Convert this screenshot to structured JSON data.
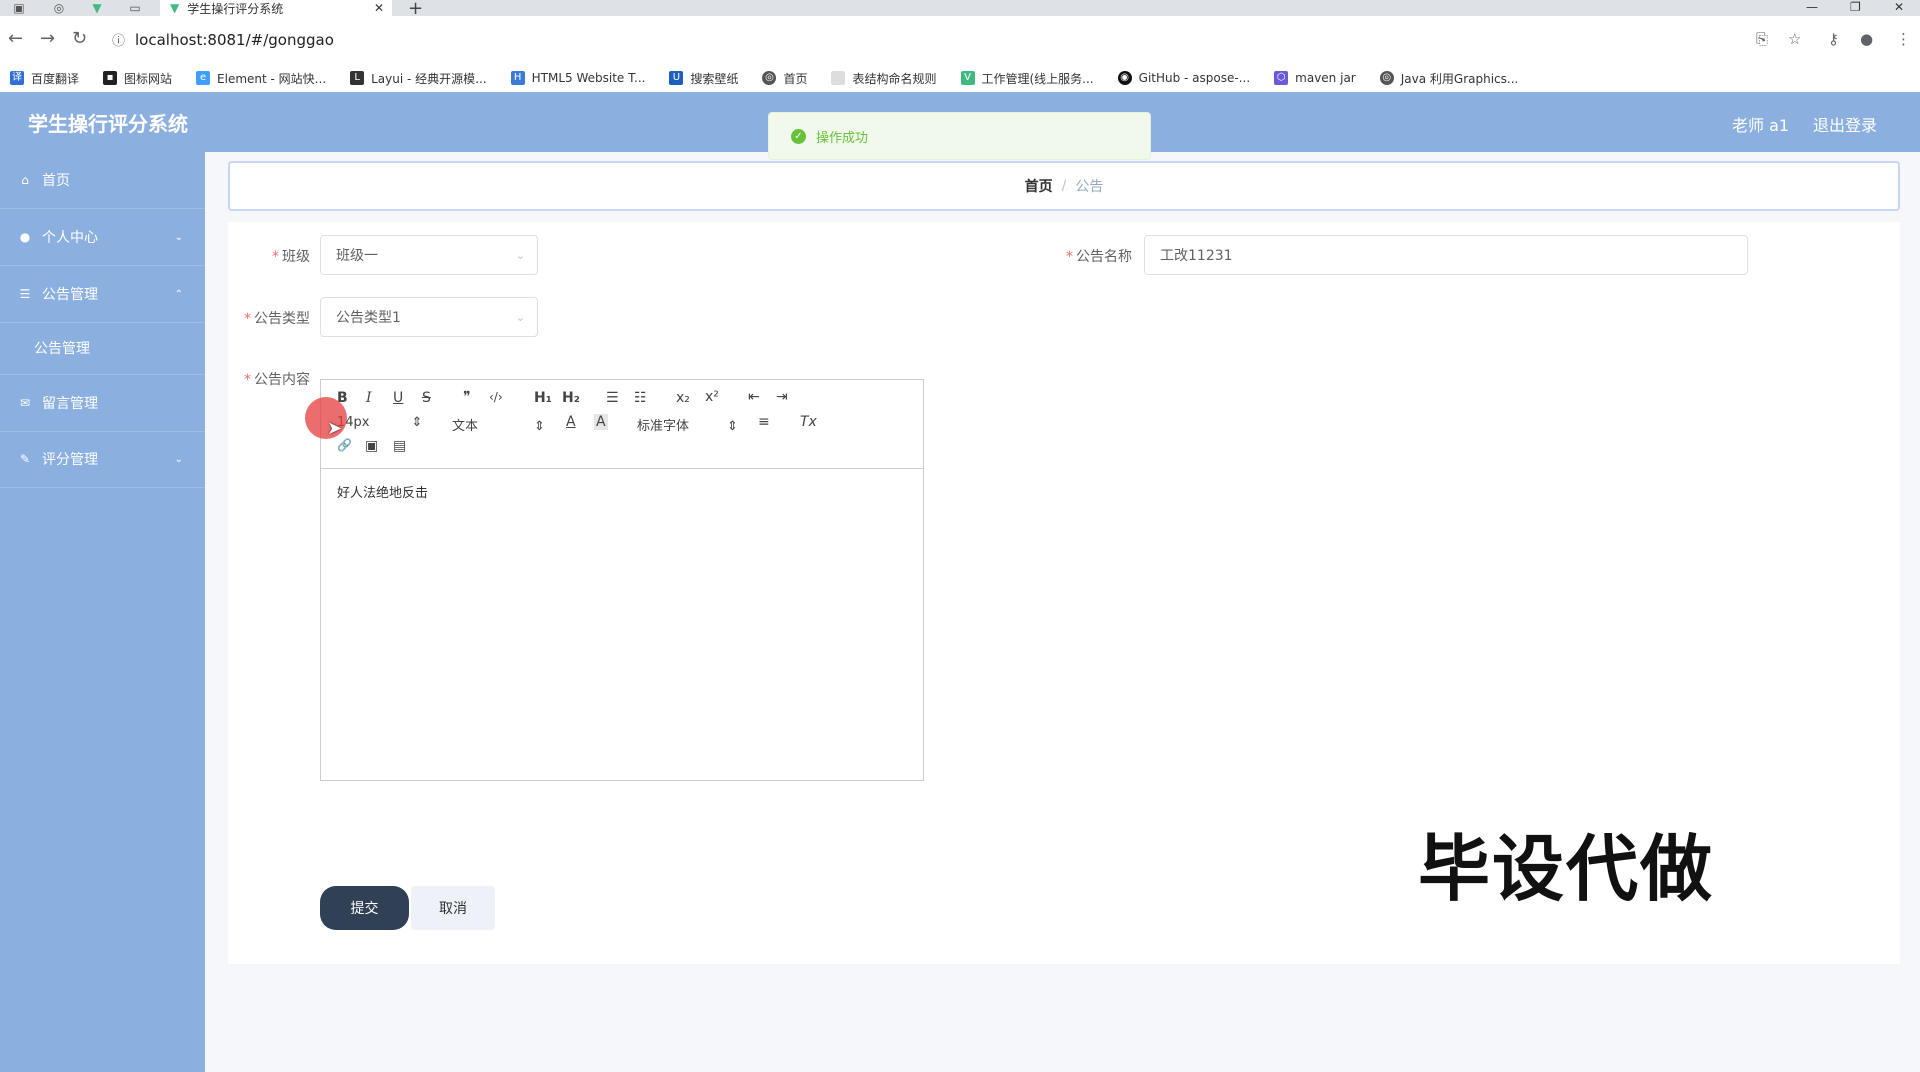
{
  "browser": {
    "active_tab_title": "学生操行评分系统",
    "url": "localhost:8081/#/gonggao",
    "bookmarks": [
      "百度翻译",
      "图标网站",
      "Element - 网站快...",
      "Layui - 经典开源模...",
      "HTML5 Website T...",
      "搜索壁纸",
      "首页",
      "表结构命名规则",
      "工作管理(线上服务...",
      "GitHub - aspose-...",
      "maven jar",
      "Java 利用Graphics..."
    ]
  },
  "header": {
    "title": "学生操行评分系统",
    "user": "老师 a1",
    "logout": "退出登录"
  },
  "toast": {
    "message": "操作成功",
    "color": "#67c23a"
  },
  "sidebar": {
    "items": [
      {
        "label": "首页",
        "icon": "home-icon"
      },
      {
        "label": "个人中心",
        "icon": "user-icon"
      },
      {
        "label": "公告管理",
        "icon": "menu-icon"
      },
      {
        "label": "公告管理",
        "icon": ""
      },
      {
        "label": "留言管理",
        "icon": "message-icon"
      },
      {
        "label": "评分管理",
        "icon": "score-icon"
      }
    ]
  },
  "breadcrumb": {
    "home": "首页",
    "separator": "/",
    "current": "公告"
  },
  "form": {
    "class_label": "班级",
    "class_value": "班级一",
    "name_label": "公告名称",
    "name_value": "工改11231",
    "type_label": "公告类型",
    "type_value": "公告类型1",
    "content_label": "公告内容",
    "content_value": "好人法绝地反击",
    "submit": "提交",
    "cancel": "取消"
  },
  "editor": {
    "font_size": "14px",
    "heading": "文本",
    "font_family": "标准字体",
    "bold": "B",
    "italic": "I",
    "underline": "U",
    "strike": "S",
    "quote": "❞",
    "code": "‹/›",
    "h1": "H₁",
    "h2": "H₂",
    "ordered_list": "☰",
    "bullet_list": "☷",
    "subscript": "x₂",
    "superscript": "x²",
    "outdent": "⇤",
    "indent": "⇥",
    "color": "A",
    "background": "A",
    "align": "≡",
    "clean": "Tx",
    "link": "🔗",
    "image": "▣",
    "video": "▤"
  },
  "watermark": "毕设代做",
  "colors": {
    "sidebar_bg": "#8bb0e0",
    "primary_button": "#304156",
    "required": "#f56c6c"
  }
}
